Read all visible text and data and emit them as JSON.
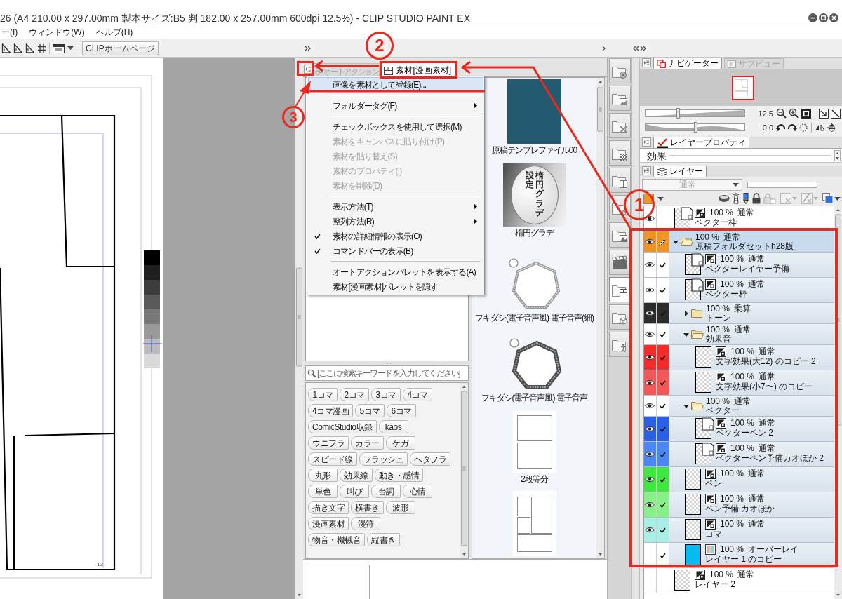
{
  "window": {
    "title": "26 (A4 210.00 x 297.00mm 製本サイズ:B5 判 182.00 x 257.00mm 600dpi 12.5%) - CLIP STUDIO PAINT EX"
  },
  "menu_bar": [
    "ー(I)",
    "ウィンドウ(W)",
    "ヘルプ(H)"
  ],
  "toolbar": {
    "home_button": "CLIPホームページ"
  },
  "canvas": {
    "page_number": "13"
  },
  "material_palette": {
    "tabs": [
      {
        "label": "オートアクション",
        "selected": false
      },
      {
        "label": "素材[漫画素材]",
        "selected": true
      }
    ],
    "search": {
      "placeholder": "[ここに検索キーワードを入力してください]"
    },
    "tag_rows": [
      [
        "1コマ",
        "2コマ",
        "3コマ",
        "4コマ"
      ],
      [
        "4コマ漫画",
        "5コマ",
        "6コマ"
      ],
      [
        "ComicStudio収録",
        "kaos"
      ],
      [
        "ウニフラ",
        "カラー",
        "ケガ"
      ],
      [
        "スピード線",
        "フラッシュ",
        "ベタフラ"
      ],
      [
        "丸形",
        "効果線",
        "動き・感情"
      ],
      [
        "単色",
        "叫び",
        "台詞",
        "心情"
      ],
      [
        "描き文字",
        "横書き",
        "波形"
      ],
      [
        "漫画素材",
        "漫符"
      ],
      [
        "物音・機械音",
        "縦書き"
      ]
    ],
    "materials": [
      {
        "kind": "photo",
        "label": "原稿テンプレファイル00"
      },
      {
        "kind": "gradient",
        "label": "楕円グラデ",
        "thumbnail_text": [
          "設定",
          "楕円グラデ"
        ]
      },
      {
        "kind": "balloon_thin",
        "label": "フキダシ(電子音声風)-電子音声(細)"
      },
      {
        "kind": "balloon_thick",
        "label": "フキダシ(電子音声風)-電子音声"
      },
      {
        "kind": "panels_two",
        "label": "2段等分"
      },
      {
        "kind": "panels_four"
      }
    ]
  },
  "context_menu": {
    "items": [
      {
        "kind": "item",
        "label": "画像を素材として登録(E)...",
        "selected": true,
        "disabled": false,
        "checked": false,
        "submenu": false
      },
      {
        "kind": "separator"
      },
      {
        "kind": "item",
        "label": "フォルダータグ(F)",
        "selected": false,
        "disabled": false,
        "checked": false,
        "submenu": true
      },
      {
        "kind": "separator"
      },
      {
        "kind": "item",
        "label": "チェックボックスを使用して選択(M)",
        "selected": false,
        "disabled": false,
        "checked": false,
        "submenu": false
      },
      {
        "kind": "item",
        "label": "素材をキャンバスに貼り付け(P)",
        "selected": false,
        "disabled": true,
        "checked": false,
        "submenu": false
      },
      {
        "kind": "item",
        "label": "素材を貼り替え(S)",
        "selected": false,
        "disabled": true,
        "checked": false,
        "submenu": false
      },
      {
        "kind": "item",
        "label": "素材のプロパティ(I)",
        "selected": false,
        "disabled": true,
        "checked": false,
        "submenu": false
      },
      {
        "kind": "item",
        "label": "素材を削除(D)",
        "selected": false,
        "disabled": true,
        "checked": false,
        "submenu": false
      },
      {
        "kind": "separator"
      },
      {
        "kind": "item",
        "label": "表示方法(T)",
        "selected": false,
        "disabled": false,
        "checked": false,
        "submenu": true
      },
      {
        "kind": "item",
        "label": "整列方法(R)",
        "selected": false,
        "disabled": false,
        "checked": false,
        "submenu": true
      },
      {
        "kind": "item",
        "label": "素材の詳細情報の表示(O)",
        "selected": false,
        "disabled": false,
        "checked": true,
        "submenu": false
      },
      {
        "kind": "item",
        "label": "コマンドバーの表示(B)",
        "selected": false,
        "disabled": false,
        "checked": true,
        "submenu": false
      },
      {
        "kind": "separator"
      },
      {
        "kind": "item",
        "label": "オートアクションパレットを表示する(A)",
        "selected": false,
        "disabled": false,
        "checked": false,
        "submenu": false
      },
      {
        "kind": "item",
        "label": "素材[漫画素材]パレットを隠す",
        "selected": false,
        "disabled": false,
        "checked": false,
        "submenu": false
      }
    ]
  },
  "dock_icons": [
    {
      "kind": "circle",
      "selected": false
    },
    {
      "kind": "picture",
      "selected": false
    },
    {
      "kind": "cross",
      "selected": false
    },
    {
      "kind": "tone",
      "selected": false
    },
    {
      "kind": "layout",
      "selected": false
    },
    {
      "kind": "lines",
      "selected": false
    },
    {
      "kind": "landscape",
      "selected": false
    },
    {
      "kind": "clapper",
      "selected": false
    },
    {
      "kind": "panel",
      "selected": true
    },
    {
      "kind": "cube",
      "selected": false
    },
    {
      "kind": "figure",
      "selected": false
    }
  ],
  "navigator": {
    "tabs": [
      {
        "label": "ナビゲーター",
        "selected": true
      },
      {
        "label": "サブビュー",
        "selected": false
      }
    ],
    "zoom": {
      "reading": "12.5",
      "level": 0.33
    },
    "rotation": {
      "reading": "0.0",
      "level": 0.5
    }
  },
  "layer_property": {
    "tab": "レイヤープロパティ",
    "section": "効果"
  },
  "layers": {
    "tab": "レイヤー",
    "blend_mode": {
      "value": "通常",
      "disabled": true
    },
    "items": [
      {
        "kind": "vector",
        "opacity": "100 %",
        "blend": "通常",
        "name": "ベクター枠",
        "visible": true,
        "checked": false,
        "selected": false
      },
      {
        "kind": "folder",
        "opacity": "100 %",
        "blend": "通常",
        "name": "原稿フォルダセットh28版",
        "visible": true,
        "checked": false,
        "selected": true,
        "color": "#f29422",
        "expanded": true,
        "children": [
          {
            "kind": "vector",
            "opacity": "100 %",
            "blend": "通常",
            "name": "ベクターレイヤー予備",
            "visible": true,
            "checked": true,
            "selected": false
          },
          {
            "kind": "vector",
            "opacity": "100 %",
            "blend": "通常",
            "name": "ベクター枠",
            "visible": true,
            "checked": true,
            "selected": false
          },
          {
            "kind": "folder",
            "opacity": "100 %",
            "blend": "乗算",
            "name": "トーン",
            "visible": true,
            "checked": true,
            "selected": false,
            "color": "#2b2b2b",
            "expanded": false
          },
          {
            "kind": "folder",
            "opacity": "100 %",
            "blend": "通常",
            "name": "効果音",
            "visible": true,
            "checked": true,
            "selected": false,
            "expanded": true,
            "children": [
              {
                "kind": "raster",
                "opacity": "100 %",
                "blend": "通常",
                "name": "文字効果(大12) のコピー 2",
                "visible": true,
                "checked": true,
                "selected": false,
                "color": "#f52b2b"
              },
              {
                "kind": "raster",
                "opacity": "100 %",
                "blend": "通常",
                "name": "文字効果(小7〜) のコピー",
                "visible": true,
                "checked": true,
                "selected": false,
                "color": "#f45757"
              }
            ]
          },
          {
            "kind": "folder",
            "opacity": "100 %",
            "blend": "通常",
            "name": "ベクター",
            "visible": true,
            "checked": true,
            "selected": false,
            "expanded": true,
            "children": [
              {
                "kind": "vector",
                "opacity": "100 %",
                "blend": "通常",
                "name": "ベクターペン 2",
                "visible": true,
                "checked": true,
                "selected": false,
                "color": "#2b5fe6"
              },
              {
                "kind": "vector",
                "opacity": "100 %",
                "blend": "通常",
                "name": "ベクターペン予備カオほか 2",
                "visible": true,
                "checked": true,
                "selected": false,
                "color": "#4a87f2"
              }
            ]
          },
          {
            "kind": "raster",
            "opacity": "100 %",
            "blend": "通常",
            "name": "ペン",
            "visible": true,
            "checked": true,
            "selected": false,
            "color": "#3fe83f"
          },
          {
            "kind": "raster",
            "opacity": "100 %",
            "blend": "通常",
            "name": "ペン予備 カオほか",
            "visible": true,
            "checked": true,
            "selected": false,
            "color": "#87f087"
          },
          {
            "kind": "raster",
            "opacity": "100 %",
            "blend": "通常",
            "name": "コマ",
            "visible": true,
            "checked": true,
            "selected": false,
            "color": "#a8efe6"
          },
          {
            "kind": "fill",
            "opacity": "100 %",
            "blend": "オーバーレイ",
            "name": "レイヤー 1 のコピー",
            "visible": false,
            "checked": true,
            "selected": false
          }
        ]
      },
      {
        "kind": "raster",
        "opacity": "100 %",
        "blend": "通常",
        "name": "レイヤー 2",
        "visible": false,
        "checked": false,
        "selected": false
      }
    ]
  },
  "annotations": [
    {
      "number": "1"
    },
    {
      "number": "2"
    },
    {
      "number": "3"
    }
  ]
}
